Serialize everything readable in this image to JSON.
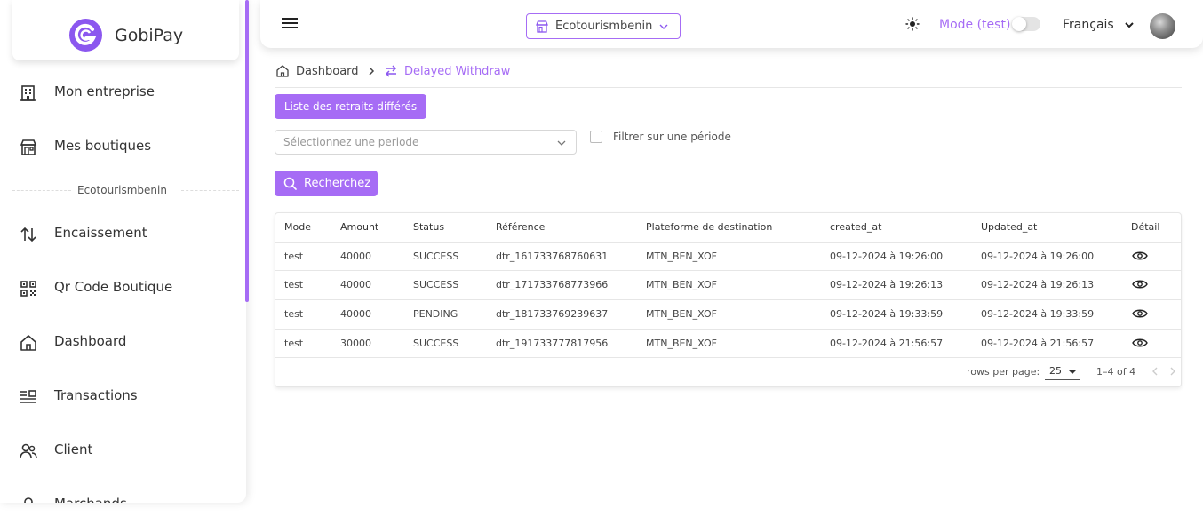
{
  "brand": {
    "name": "GobiPay"
  },
  "sidebar": {
    "items": [
      {
        "label": "Mon entreprise"
      },
      {
        "label": "Mes boutiques"
      },
      {
        "label": "Encaissement"
      },
      {
        "label": "Qr Code Boutique"
      },
      {
        "label": "Dashboard"
      },
      {
        "label": "Transactions"
      },
      {
        "label": "Client"
      },
      {
        "label": "Marchands"
      }
    ],
    "section_label": "Ecotourismbenin"
  },
  "header": {
    "shop": "Ecotourismbenin",
    "mode_label": "Mode (test)",
    "language": "Français"
  },
  "breadcrumb": {
    "home": "Dashboard",
    "current": "Delayed Withdraw"
  },
  "controls": {
    "list_button": "Liste des retraits différés",
    "period_placeholder": "Sélectionnez une periode",
    "filter_label": "Filtrer sur une période",
    "search_button": "Recherchez"
  },
  "table": {
    "columns": [
      "Mode",
      "Amount",
      "Status",
      "Référence",
      "Plateforme de destination",
      "created_at",
      "Updated_at",
      "Détail"
    ],
    "rows": [
      [
        "test",
        "40000",
        "SUCCESS",
        "dtr_161733768760631",
        "MTN_BEN_XOF",
        "09-12-2024 à 19:26:00",
        "09-12-2024 à 19:26:00"
      ],
      [
        "test",
        "40000",
        "SUCCESS",
        "dtr_171733768773966",
        "MTN_BEN_XOF",
        "09-12-2024 à 19:26:13",
        "09-12-2024 à 19:26:13"
      ],
      [
        "test",
        "40000",
        "PENDING",
        "dtr_181733769239637",
        "MTN_BEN_XOF",
        "09-12-2024 à 19:33:59",
        "09-12-2024 à 19:33:59"
      ],
      [
        "test",
        "30000",
        "SUCCESS",
        "dtr_191733777817956",
        "MTN_BEN_XOF",
        "09-12-2024 à 21:56:57",
        "09-12-2024 à 21:56:57"
      ]
    ],
    "rows_per_page_label": "rows per page:",
    "rows_per_page": "25",
    "range": "1–4 of 4"
  },
  "colors": {
    "accent": "#a66cf5"
  }
}
